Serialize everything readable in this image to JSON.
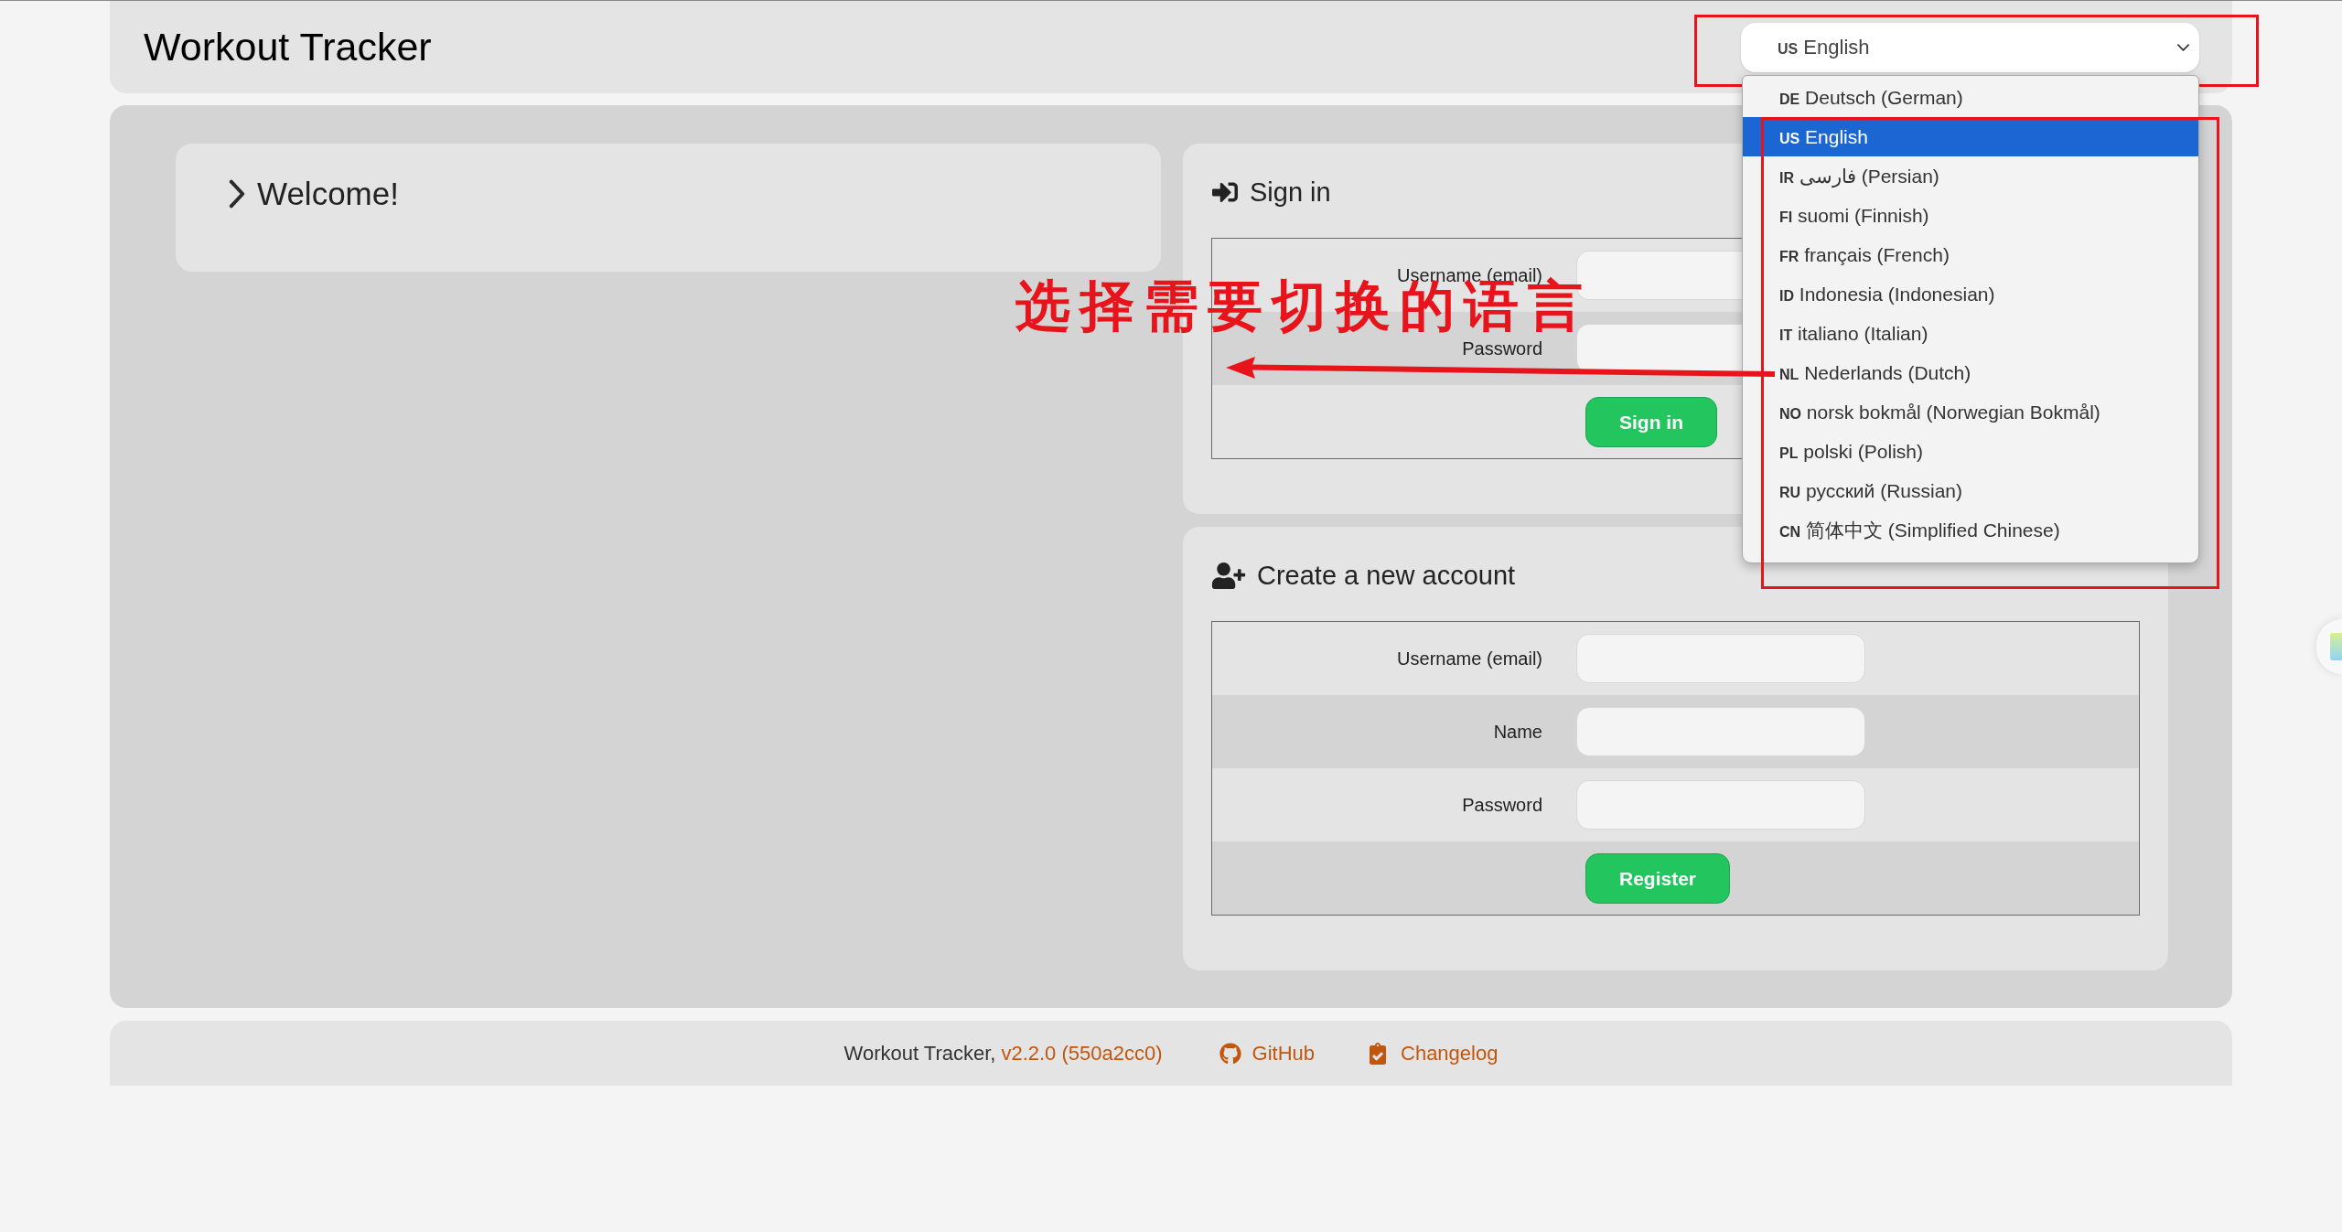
{
  "header": {
    "title": "Workout Tracker",
    "language_select": {
      "code": "US",
      "label": "English",
      "expanded": true
    }
  },
  "language_options": [
    {
      "code": "DE",
      "label": "Deutsch (German)",
      "selected": false
    },
    {
      "code": "US",
      "label": "English",
      "selected": true
    },
    {
      "code": "IR",
      "label": "فارسی (Persian)",
      "selected": false
    },
    {
      "code": "FI",
      "label": "suomi (Finnish)",
      "selected": false
    },
    {
      "code": "FR",
      "label": "français (French)",
      "selected": false
    },
    {
      "code": "ID",
      "label": "Indonesia (Indonesian)",
      "selected": false
    },
    {
      "code": "IT",
      "label": "italiano (Italian)",
      "selected": false
    },
    {
      "code": "NL",
      "label": "Nederlands (Dutch)",
      "selected": false
    },
    {
      "code": "NO",
      "label": "norsk bokmål (Norwegian Bokmål)",
      "selected": false
    },
    {
      "code": "PL",
      "label": "polski (Polish)",
      "selected": false
    },
    {
      "code": "RU",
      "label": "русский (Russian)",
      "selected": false
    },
    {
      "code": "CN",
      "label": "简体中文 (Simplified Chinese)",
      "selected": false
    }
  ],
  "welcome": {
    "title": "Welcome!",
    "expanded": false
  },
  "sign_in": {
    "title": "Sign in",
    "fields": [
      {
        "label": "Username (email)"
      },
      {
        "label": "Password"
      }
    ],
    "button": "Sign in"
  },
  "register": {
    "title": "Create a new account",
    "fields": [
      {
        "label": "Username (email)"
      },
      {
        "label": "Name"
      },
      {
        "label": "Password"
      }
    ],
    "button": "Register"
  },
  "footer": {
    "text": "Workout Tracker,",
    "version_link": "v2.2.0 (550a2cc0)",
    "links": [
      {
        "label": "GitHub"
      },
      {
        "label": "Changelog"
      }
    ]
  },
  "annotation": {
    "text": "选择需要切换的语言"
  }
}
